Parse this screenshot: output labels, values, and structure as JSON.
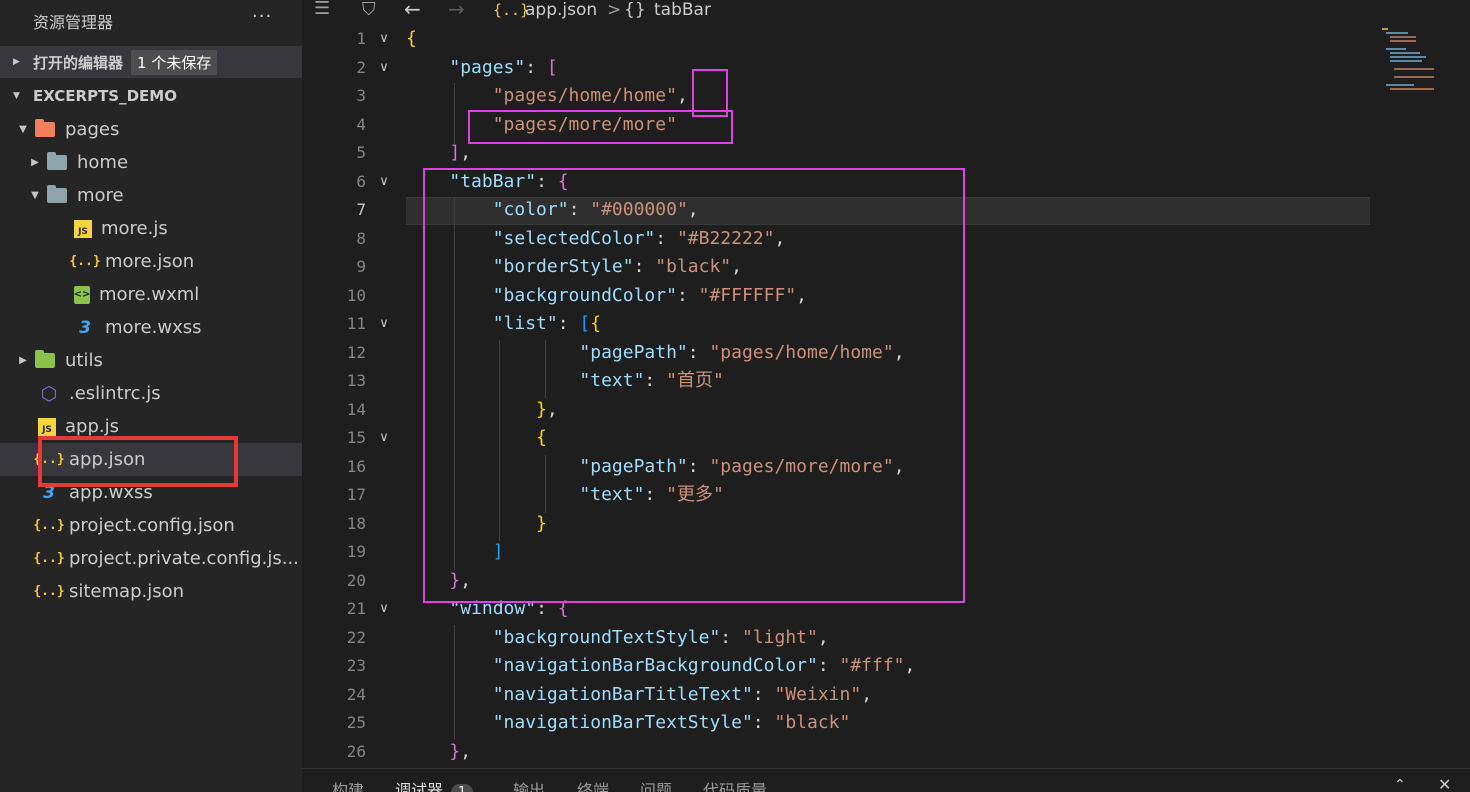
{
  "sidebar": {
    "title": "资源管理器",
    "more_actions": "···",
    "open_editors": {
      "label": "打开的编辑器",
      "badge": "1 个未保存"
    },
    "project": {
      "label": "EXCERPTS_DEMO"
    },
    "tree": [
      {
        "label": "pages",
        "icon": "folder-pages-icon",
        "expanded": true
      },
      {
        "label": "home",
        "icon": "folder-icon",
        "expanded": false
      },
      {
        "label": "more",
        "icon": "folder-open-icon",
        "expanded": true
      },
      {
        "label": "more.js",
        "icon": "js-file-icon",
        "icon_text": "JS"
      },
      {
        "label": "more.json",
        "icon": "json-file-icon",
        "icon_text": "{..}"
      },
      {
        "label": "more.wxml",
        "icon": "wxml-file-icon",
        "icon_text": "<>"
      },
      {
        "label": "more.wxss",
        "icon": "css-file-icon",
        "icon_text": "3"
      },
      {
        "label": "utils",
        "icon": "folder-utils-icon",
        "expanded": false
      },
      {
        "label": ".eslintrc.js",
        "icon": "eslint-icon",
        "icon_text": "⬡"
      },
      {
        "label": "app.js",
        "icon": "js-file-icon",
        "icon_text": "JS"
      },
      {
        "label": "app.json",
        "icon": "json-file-icon",
        "icon_text": "{..}",
        "selected": true
      },
      {
        "label": "app.wxss",
        "icon": "css-file-icon",
        "icon_text": "3"
      },
      {
        "label": "project.config.json",
        "icon": "json-file-icon",
        "icon_text": "{..}"
      },
      {
        "label": "project.private.config.js...",
        "icon": "json-file-icon",
        "icon_text": "{..}"
      },
      {
        "label": "sitemap.json",
        "icon": "json-file-icon",
        "icon_text": "{..}"
      }
    ]
  },
  "breadcrumb": {
    "file_icon": "{..}",
    "file": "app.json",
    "separator": ">",
    "symbol_icon": "{}",
    "symbol": "tabBar"
  },
  "editor": {
    "active_line": 7,
    "line_numbers": [
      "1",
      "2",
      "3",
      "4",
      "5",
      "6",
      "7",
      "8",
      "9",
      "10",
      "11",
      "12",
      "13",
      "14",
      "15",
      "16",
      "17",
      "18",
      "19",
      "20",
      "21",
      "22",
      "23",
      "24",
      "25",
      "26"
    ],
    "lines": [
      [
        [
          "b1",
          "{"
        ]
      ],
      [
        [
          "p",
          "    "
        ],
        [
          "k",
          "\"pages\""
        ],
        [
          "p",
          ": "
        ],
        [
          "b2",
          "["
        ]
      ],
      [
        [
          "p",
          "        "
        ],
        [
          "s",
          "\"pages/home/home\""
        ],
        [
          "p",
          ","
        ]
      ],
      [
        [
          "p",
          "        "
        ],
        [
          "s",
          "\"pages/more/more\""
        ]
      ],
      [
        [
          "p",
          "    "
        ],
        [
          "b2",
          "]"
        ],
        [
          "p",
          ","
        ]
      ],
      [
        [
          "p",
          "    "
        ],
        [
          "k",
          "\"tabBar\""
        ],
        [
          "p",
          ": "
        ],
        [
          "b2",
          "{"
        ]
      ],
      [
        [
          "p",
          "        "
        ],
        [
          "k",
          "\"color\""
        ],
        [
          "p",
          ": "
        ],
        [
          "s",
          "\"#000000\""
        ],
        [
          "p",
          ","
        ]
      ],
      [
        [
          "p",
          "        "
        ],
        [
          "k",
          "\"selectedColor\""
        ],
        [
          "p",
          ": "
        ],
        [
          "s",
          "\"#B22222\""
        ],
        [
          "p",
          ","
        ]
      ],
      [
        [
          "p",
          "        "
        ],
        [
          "k",
          "\"borderStyle\""
        ],
        [
          "p",
          ": "
        ],
        [
          "s",
          "\"black\""
        ],
        [
          "p",
          ","
        ]
      ],
      [
        [
          "p",
          "        "
        ],
        [
          "k",
          "\"backgroundColor\""
        ],
        [
          "p",
          ": "
        ],
        [
          "s",
          "\"#FFFFFF\""
        ],
        [
          "p",
          ","
        ]
      ],
      [
        [
          "p",
          "        "
        ],
        [
          "k",
          "\"list\""
        ],
        [
          "p",
          ": "
        ],
        [
          "b3",
          "["
        ],
        [
          "b1",
          "{"
        ]
      ],
      [
        [
          "p",
          "                "
        ],
        [
          "k",
          "\"pagePath\""
        ],
        [
          "p",
          ": "
        ],
        [
          "s",
          "\"pages/home/home\""
        ],
        [
          "p",
          ","
        ]
      ],
      [
        [
          "p",
          "                "
        ],
        [
          "k",
          "\"text\""
        ],
        [
          "p",
          ": "
        ],
        [
          "s",
          "\"首页\""
        ]
      ],
      [
        [
          "p",
          "            "
        ],
        [
          "b1",
          "}"
        ],
        [
          "p",
          ","
        ]
      ],
      [
        [
          "p",
          "            "
        ],
        [
          "b1",
          "{"
        ]
      ],
      [
        [
          "p",
          "                "
        ],
        [
          "k",
          "\"pagePath\""
        ],
        [
          "p",
          ": "
        ],
        [
          "s",
          "\"pages/more/more\""
        ],
        [
          "p",
          ","
        ]
      ],
      [
        [
          "p",
          "                "
        ],
        [
          "k",
          "\"text\""
        ],
        [
          "p",
          ": "
        ],
        [
          "s",
          "\"更多\""
        ]
      ],
      [
        [
          "p",
          "            "
        ],
        [
          "b1",
          "}"
        ]
      ],
      [
        [
          "p",
          "        "
        ],
        [
          "b3",
          "]"
        ]
      ],
      [
        [
          "p",
          "    "
        ],
        [
          "b2",
          "}"
        ],
        [
          "p",
          ","
        ]
      ],
      [
        [
          "p",
          "    "
        ],
        [
          "k",
          "\"window\""
        ],
        [
          "p",
          ": "
        ],
        [
          "b2",
          "{"
        ]
      ],
      [
        [
          "p",
          "        "
        ],
        [
          "k",
          "\"backgroundTextStyle\""
        ],
        [
          "p",
          ": "
        ],
        [
          "s",
          "\"light\""
        ],
        [
          "p",
          ","
        ]
      ],
      [
        [
          "p",
          "        "
        ],
        [
          "k",
          "\"navigationBarBackgroundColor\""
        ],
        [
          "p",
          ": "
        ],
        [
          "s",
          "\"#fff\""
        ],
        [
          "p",
          ","
        ]
      ],
      [
        [
          "p",
          "        "
        ],
        [
          "k",
          "\"navigationBarTitleText\""
        ],
        [
          "p",
          ": "
        ],
        [
          "s",
          "\"Weixin\""
        ],
        [
          "p",
          ","
        ]
      ],
      [
        [
          "p",
          "        "
        ],
        [
          "k",
          "\"navigationBarTextStyle\""
        ],
        [
          "p",
          ": "
        ],
        [
          "s",
          "\"black\""
        ]
      ],
      [
        [
          "p",
          "    "
        ],
        [
          "b2",
          "}"
        ],
        [
          "p",
          ","
        ]
      ]
    ],
    "fold_lines": [
      1,
      2,
      6,
      11,
      15,
      21
    ]
  },
  "panel": {
    "tabs": [
      "构建",
      "调试器",
      "输出",
      "终端",
      "问题",
      "代码质量"
    ],
    "active_tab": "调试器",
    "debugger_badge": "1"
  },
  "colors": {
    "highlight_pink": "#e040e8",
    "highlight_red": "#e53935",
    "json_key": "#9cdcfe",
    "json_string": "#ce9178"
  }
}
